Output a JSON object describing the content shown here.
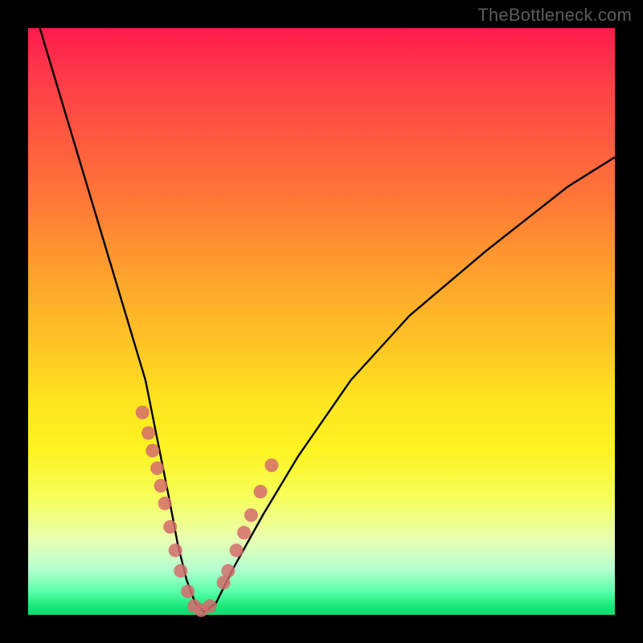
{
  "watermark": "TheBottleneck.com",
  "chart_data": {
    "type": "line",
    "title": "",
    "xlabel": "",
    "ylabel": "",
    "xlim": [
      0,
      100
    ],
    "ylim": [
      0,
      100
    ],
    "grid": false,
    "series": [
      {
        "name": "bottleneck-curve",
        "color": "#000000",
        "x": [
          2,
          5,
          8,
          11,
          14,
          17,
          20,
          22,
          24,
          25.5,
          27,
          28.5,
          30,
          32,
          35,
          40,
          46,
          55,
          65,
          78,
          92,
          100
        ],
        "y": [
          100,
          90,
          80,
          70,
          60,
          50,
          40,
          30,
          20,
          12,
          6,
          2,
          0.5,
          2,
          8,
          17,
          27,
          40,
          51,
          62,
          73,
          78
        ]
      },
      {
        "name": "data-dots",
        "color": "#d46c6c",
        "x": [
          19.5,
          20.5,
          21.2,
          22.0,
          22.6,
          23.3,
          24.2,
          25.1,
          26.0,
          27.2,
          28.3,
          29.5,
          31.0,
          33.3,
          34.1,
          35.5,
          36.8,
          38.0,
          39.6,
          41.5
        ],
        "y": [
          34.5,
          31.0,
          28.0,
          25.0,
          22.0,
          19.0,
          15.0,
          11.0,
          7.5,
          4.0,
          1.5,
          0.8,
          1.5,
          5.5,
          7.5,
          11.0,
          14.0,
          17.0,
          21.0,
          25.5
        ]
      }
    ],
    "min_point": {
      "x": 29.5,
      "y": 0.5
    }
  },
  "colors": {
    "frame": "#000000",
    "curve": "#000000",
    "dots": "#d46c6c",
    "watermark": "#5c5c5c"
  }
}
